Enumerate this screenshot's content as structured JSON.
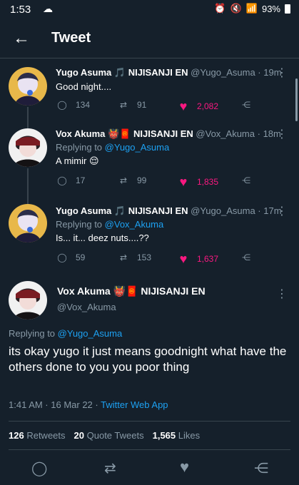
{
  "status": {
    "time": "1:53",
    "battery": "93%"
  },
  "header": {
    "title": "Tweet"
  },
  "tweets": [
    {
      "display_name": "Yugo Asuma",
      "affiliation": "NIJISANJI EN",
      "handle": "@Yugo_Asuma",
      "time": "· 19m",
      "reply_prefix": "",
      "reply_handle": "",
      "text": "Good night....",
      "replies": "134",
      "retweets": "91",
      "likes": "2,082"
    },
    {
      "display_name": "Vox Akuma",
      "affiliation": "NIJISANJI EN",
      "handle": "@Vox_Akuma",
      "time": "· 18m",
      "reply_prefix": "Replying to",
      "reply_handle": "@Yugo_Asuma",
      "text": "A mimir 😌",
      "replies": "17",
      "retweets": "99",
      "likes": "1,835"
    },
    {
      "display_name": "Yugo Asuma",
      "affiliation": "NIJISANJI EN",
      "handle": "@Yugo_Asuma",
      "time": "· 17m",
      "reply_prefix": "Replying to",
      "reply_handle": "@Vox_Akuma",
      "text": "Is... it... deez nuts....??",
      "replies": "59",
      "retweets": "153",
      "likes": "1,637"
    }
  ],
  "main_tweet": {
    "display_name": "Vox Akuma",
    "affiliation": "NIJISANJI EN",
    "handle": "@Vox_Akuma",
    "reply_prefix": "Replying to",
    "reply_handle": "@Yugo_Asuma",
    "text": "its okay yugo it just means goodnight what have the others done to you you poor thing",
    "datetime": "1:41 AM · 16 Mar 22 · ",
    "app": "Twitter Web App",
    "retweets_count": "126",
    "retweets_label": "Retweets",
    "quotes_count": "20",
    "quotes_label": "Quote Tweets",
    "likes_count": "1,565",
    "likes_label": "Likes"
  },
  "icons": {
    "back": "arrow-left-icon",
    "reply": "speech-bubble-icon",
    "retweet": "retweet-icon",
    "like": "heart-icon",
    "share": "share-icon",
    "more": "more-vertical-icon"
  },
  "colors": {
    "background": "#15202b",
    "like": "#f91880",
    "link": "#1da1f2",
    "muted": "#8899a6"
  }
}
